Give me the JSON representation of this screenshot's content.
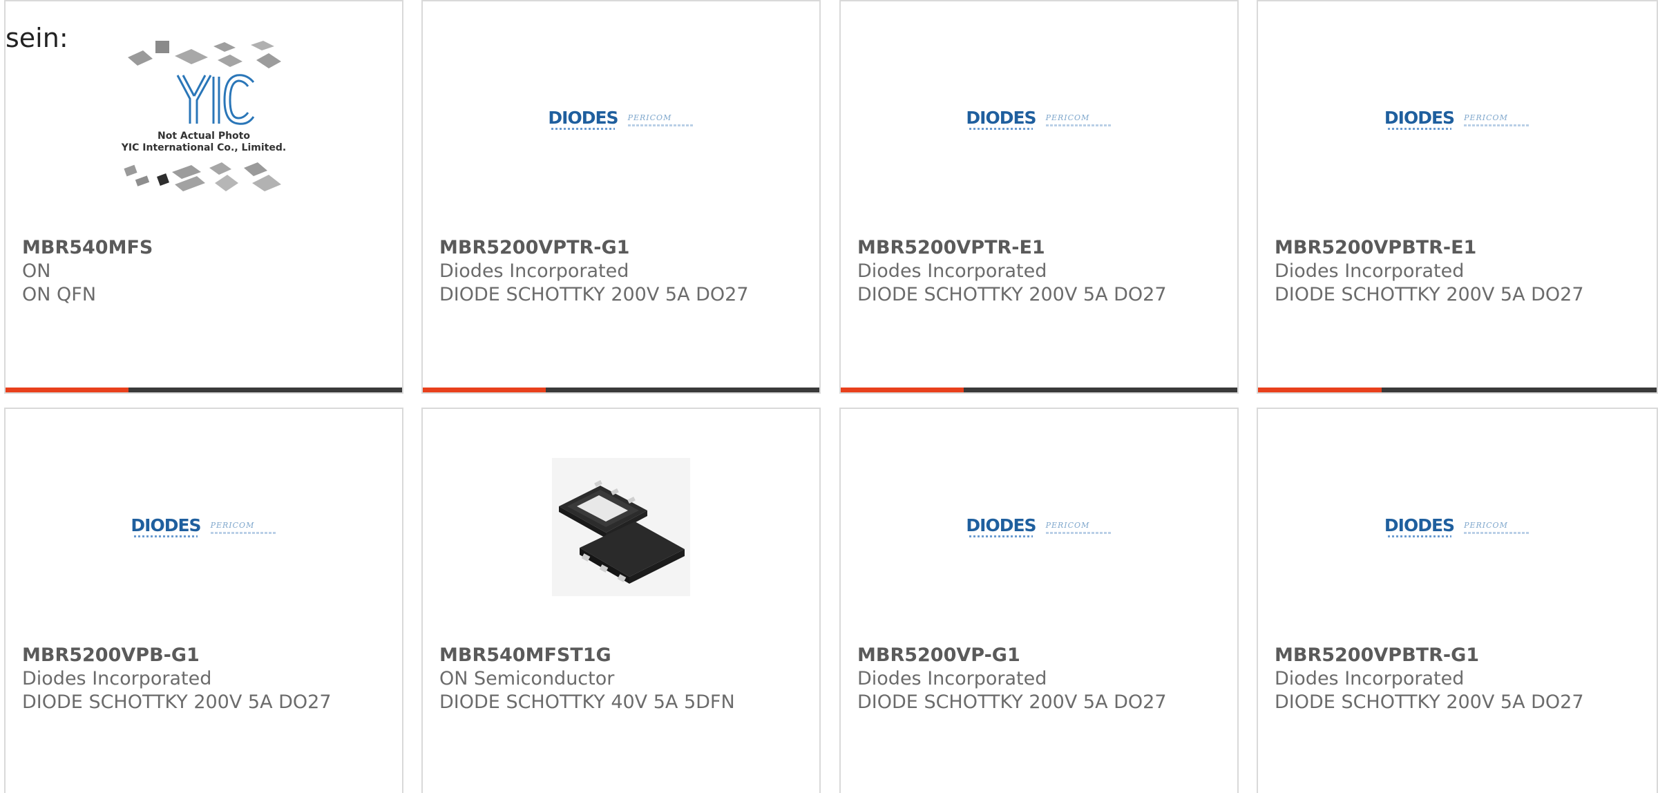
{
  "intro_text": "sein:",
  "colors": {
    "accent": "#e8401c",
    "bar_dark": "#3a3a3a",
    "border": "#d9d9d9",
    "text": "#6b6b6b"
  },
  "products": [
    {
      "part_number": "MBR540MFS",
      "manufacturer": "ON",
      "description": "ON QFN",
      "image": "not-actual-photo-placeholder",
      "image_text": [
        "Not Actual Photo",
        "YIC International Co., Limited."
      ],
      "progress": 0.31
    },
    {
      "part_number": "MBR5200VPTR-G1",
      "manufacturer": "Diodes Incorporated",
      "description": "DIODE SCHOTTKY 200V 5A DO27",
      "image": "diodes-logo",
      "image_text": [
        "DIODES",
        "PERICOM"
      ],
      "progress": 0.31
    },
    {
      "part_number": "MBR5200VPTR-E1",
      "manufacturer": "Diodes Incorporated",
      "description": "DIODE SCHOTTKY 200V 5A DO27",
      "image": "diodes-logo",
      "image_text": [
        "DIODES",
        "PERICOM"
      ],
      "progress": 0.31
    },
    {
      "part_number": "MBR5200VPBTR-E1",
      "manufacturer": "Diodes Incorporated",
      "description": "DIODE SCHOTTKY 200V 5A DO27",
      "image": "diodes-logo",
      "image_text": [
        "DIODES",
        "PERICOM"
      ],
      "progress": 0.31
    },
    {
      "part_number": "MBR5200VPB-G1",
      "manufacturer": "Diodes Incorporated",
      "description": "DIODE SCHOTTKY 200V 5A DO27",
      "image": "diodes-logo",
      "image_text": [
        "DIODES",
        "PERICOM"
      ],
      "progress": null
    },
    {
      "part_number": "MBR540MFST1G",
      "manufacturer": "ON Semiconductor",
      "description": "DIODE SCHOTTKY 40V 5A 5DFN",
      "image": "dfn-package-photo",
      "image_text": [],
      "progress": null
    },
    {
      "part_number": "MBR5200VP-G1",
      "manufacturer": "Diodes Incorporated",
      "description": "DIODE SCHOTTKY 200V 5A DO27",
      "image": "diodes-logo",
      "image_text": [
        "DIODES",
        "PERICOM"
      ],
      "progress": null
    },
    {
      "part_number": "MBR5200VPBTR-G1",
      "manufacturer": "Diodes Incorporated",
      "description": "DIODE SCHOTTKY 200V 5A DO27",
      "image": "diodes-logo",
      "image_text": [
        "DIODES",
        "PERICOM"
      ],
      "progress": null
    }
  ]
}
